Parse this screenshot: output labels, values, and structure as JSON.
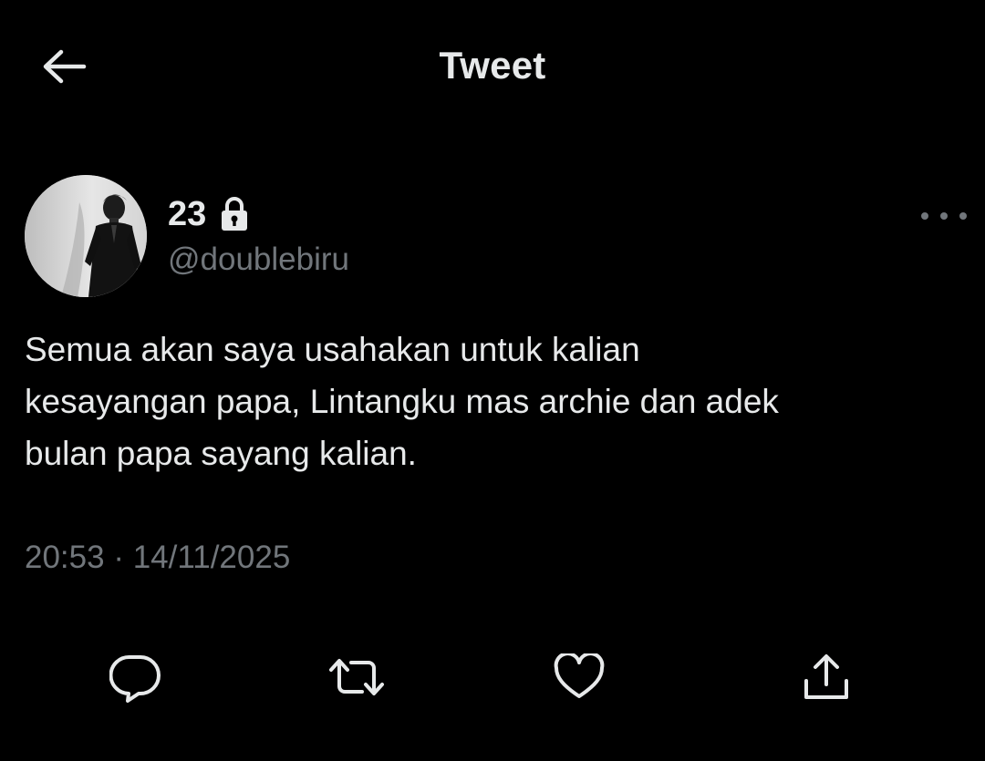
{
  "header": {
    "back_icon": "arrow-left-icon",
    "title": "Tweet"
  },
  "author": {
    "display_name": "23",
    "protected_icon": "lock-icon",
    "handle": "@doublebiru",
    "avatar": "profile-photo"
  },
  "menu": {
    "more_icon": "ellipsis-icon"
  },
  "tweet": {
    "text": "Semua akan saya usahakan untuk kalian\nkesayangan papa, Lintangku mas archie dan adek\nbulan papa sayang kalian.",
    "time": "20:53",
    "separator": "·",
    "date": "14/11/2025"
  },
  "actions": [
    {
      "name": "reply",
      "icon": "reply-icon"
    },
    {
      "name": "retweet",
      "icon": "retweet-icon"
    },
    {
      "name": "like",
      "icon": "heart-icon"
    },
    {
      "name": "share",
      "icon": "share-icon"
    }
  ],
  "colors": {
    "background": "#000000",
    "primary_text": "#e7e9ea",
    "secondary_text": "#71767b",
    "icon": "#e7e9ea"
  }
}
